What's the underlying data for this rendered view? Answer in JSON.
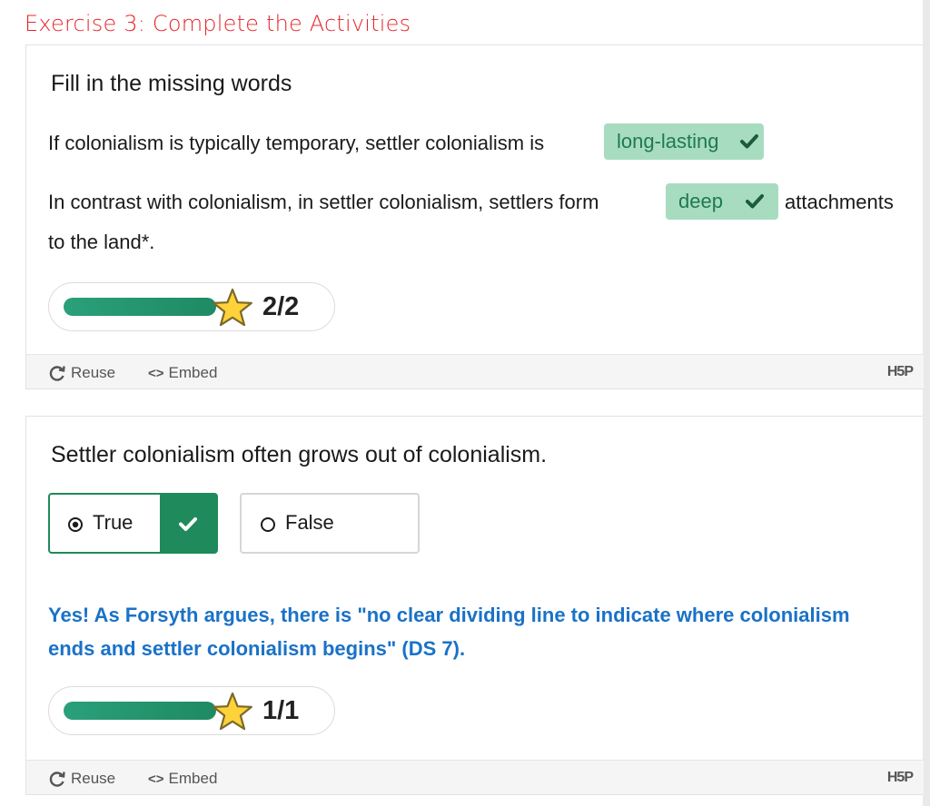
{
  "page": {
    "heading": "Exercise 3:  Complete the Activities"
  },
  "activity1": {
    "title": "Fill in the missing words",
    "sentence1_pre": "If colonialism is typically temporary, settler colonialism is",
    "blank1_answer": "long-lasting",
    "sentence2_pre": "In contrast with colonialism, in settler colonialism, settlers form",
    "blank2_answer": "deep",
    "sentence2_post": "attachments",
    "sentence2_line2": "to the land*.",
    "score": "2/2",
    "score_fraction": 1.0
  },
  "activity2": {
    "question": "Settler colonialism often grows out of colonialism.",
    "option_true": "True",
    "option_false": "False",
    "selected": "True",
    "feedback": "Yes! As Forsyth argues, there is \"no clear dividing line to indicate where colonialism ends and settler colonialism begins\" (DS 7).",
    "score": "1/1",
    "score_fraction": 1.0
  },
  "footer": {
    "reuse_label": "Reuse",
    "embed_label": "Embed",
    "logo_text": "H5P",
    "embed_icon_text": "<>"
  },
  "colors": {
    "heading": "#e8242b",
    "correct_fill": "#a8dcc0",
    "correct_text": "#1e7a4d",
    "progress": "#1f8a63",
    "feedback": "#1a72c7"
  },
  "icons": [
    "refresh-icon",
    "code-icon",
    "star-icon",
    "checkmark-icon",
    "radio-selected-icon",
    "radio-empty-icon"
  ]
}
